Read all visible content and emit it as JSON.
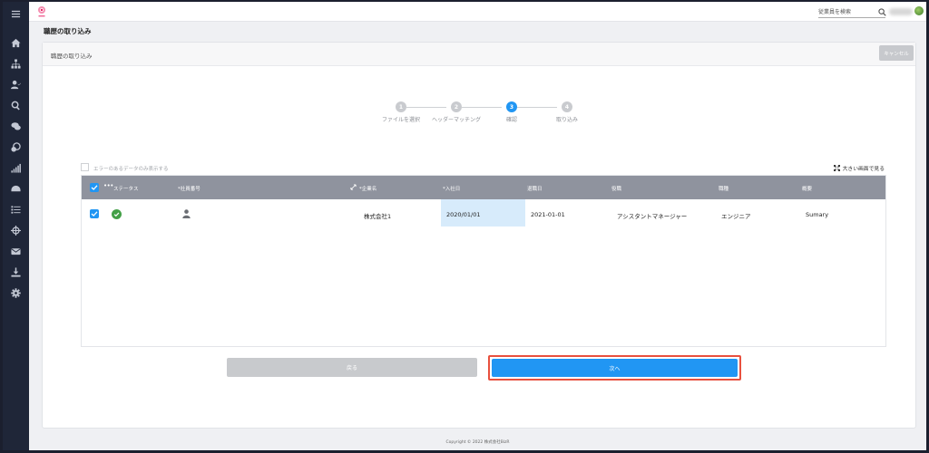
{
  "header": {
    "search_placeholder": "従業員を検索"
  },
  "page": {
    "title": "職歴の取り込み"
  },
  "card": {
    "title": "職歴の取り込み",
    "cancel_label": "キャンセル"
  },
  "stepper": {
    "active_index": 2,
    "steps": [
      {
        "number": "1",
        "label": "ファイルを選択"
      },
      {
        "number": "2",
        "label": "ヘッダーマッチング"
      },
      {
        "number": "3",
        "label": "確認"
      },
      {
        "number": "4",
        "label": "取り込み"
      }
    ]
  },
  "filter": {
    "label": "エラーのあるデータのみ表示する",
    "checked": false
  },
  "fullscreen_label": "大きい画面で見る",
  "table": {
    "headers": {
      "status": "ステータス",
      "employee_no": "*社員番号",
      "company": "*企業名",
      "join_date": "*入社日",
      "leave_date": "退職日",
      "position": "役職",
      "job_type": "職種",
      "summary": "概要"
    },
    "rows": [
      {
        "status": "ok",
        "company": "株式会社1",
        "join_date": "2020/01/01",
        "leave_date": "2021-01-01",
        "position": "アシスタントマネージャー",
        "job_type": "エンジニア",
        "summary": "Sumary"
      }
    ]
  },
  "actions": {
    "back_label": "戻る",
    "next_label": "次へ"
  },
  "footer": {
    "copyright": "Copyright © 2022 株式会社BizR"
  },
  "colors": {
    "accent": "#2196f3",
    "highlight_outline": "#e8503e",
    "sidebar": "#1f2638",
    "table_header": "#8f939e"
  }
}
